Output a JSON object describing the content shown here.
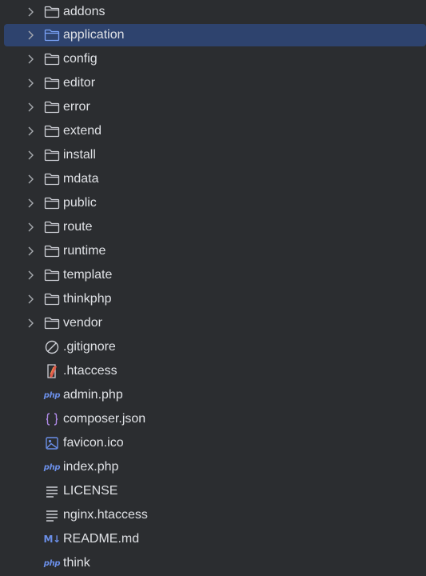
{
  "tree": {
    "folders": [
      {
        "label": "addons",
        "icon": "folder-icon"
      },
      {
        "label": "application",
        "icon": "folder-icon",
        "selected": true
      },
      {
        "label": "config",
        "icon": "folder-icon"
      },
      {
        "label": "editor",
        "icon": "folder-icon"
      },
      {
        "label": "error",
        "icon": "folder-icon"
      },
      {
        "label": "extend",
        "icon": "folder-icon"
      },
      {
        "label": "install",
        "icon": "folder-icon"
      },
      {
        "label": "mdata",
        "icon": "folder-icon"
      },
      {
        "label": "public",
        "icon": "folder-icon"
      },
      {
        "label": "route",
        "icon": "folder-icon"
      },
      {
        "label": "runtime",
        "icon": "folder-icon"
      },
      {
        "label": "template",
        "icon": "folder-icon"
      },
      {
        "label": "thinkphp",
        "icon": "folder-icon"
      },
      {
        "label": "vendor",
        "icon": "folder-icon"
      }
    ],
    "files": [
      {
        "label": ".gitignore",
        "icon": "ignore-icon"
      },
      {
        "label": ".htaccess",
        "icon": "htaccess-icon"
      },
      {
        "label": "admin.php",
        "icon": "php-icon",
        "icon_text": "php"
      },
      {
        "label": "composer.json",
        "icon": "json-icon",
        "icon_text": "{}"
      },
      {
        "label": "favicon.ico",
        "icon": "image-icon"
      },
      {
        "label": "index.php",
        "icon": "php-icon",
        "icon_text": "php"
      },
      {
        "label": "LICENSE",
        "icon": "text-file-icon"
      },
      {
        "label": "nginx.htaccess",
        "icon": "text-file-icon"
      },
      {
        "label": "README.md",
        "icon": "markdown-icon",
        "icon_text": "M↓"
      },
      {
        "label": "think",
        "icon": "php-icon",
        "icon_text": "php"
      }
    ]
  },
  "colors": {
    "background": "#2b2d30",
    "selection": "#2e436e",
    "text": "#dfe1e5",
    "icon_gray": "#ced0d6",
    "accent_blue": "#6b8fe8"
  }
}
